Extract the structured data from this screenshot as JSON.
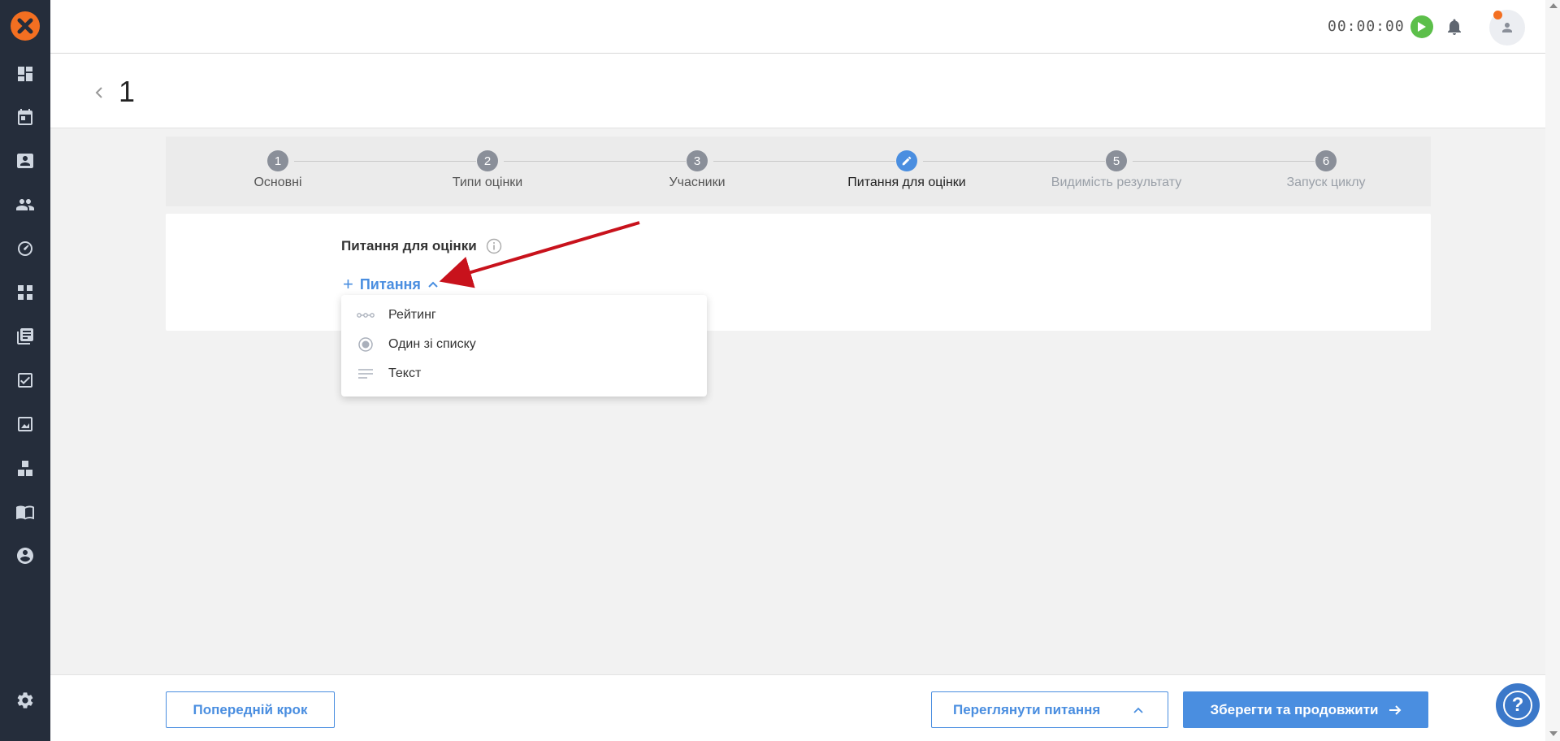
{
  "topbar": {
    "timer": "00:00:00"
  },
  "page": {
    "title": "1"
  },
  "stepper": {
    "steps": [
      {
        "number": "1",
        "label": "Основні"
      },
      {
        "number": "2",
        "label": "Типи оцінки"
      },
      {
        "number": "3",
        "label": "Учасники"
      },
      {
        "number": "",
        "label": "Питання для оцінки"
      },
      {
        "number": "5",
        "label": "Видимість результату"
      },
      {
        "number": "6",
        "label": "Запуск циклу"
      }
    ]
  },
  "section": {
    "title": "Питання для оцінки",
    "add_label": "Питання"
  },
  "dropdown": {
    "items": [
      {
        "label": "Рейтинг",
        "icon": "rating-icon"
      },
      {
        "label": "Один зі списку",
        "icon": "radio-icon"
      },
      {
        "label": "Текст",
        "icon": "text-lines-icon"
      }
    ]
  },
  "footer": {
    "prev_label": "Попередній крок",
    "preview_label": "Переглянути питання",
    "save_label": "Зберегти та продовжити"
  },
  "colors": {
    "accent": "#4a8ee0",
    "sidebar": "#252d3b",
    "brand": "#f36f21",
    "play": "#5cbf4a",
    "annotation": "#c8121c"
  }
}
